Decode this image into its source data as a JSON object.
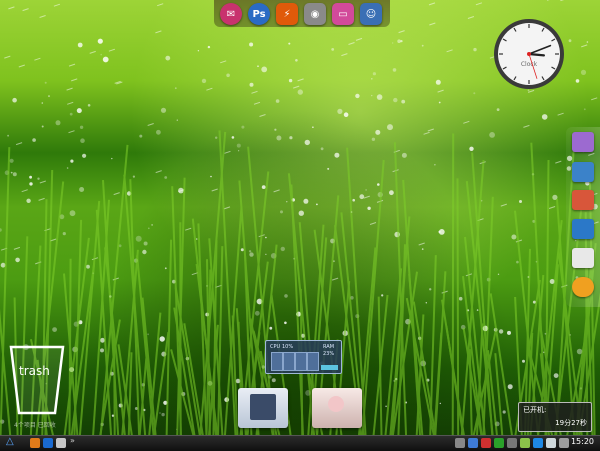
{
  "desktop": {
    "trash": {
      "label": "trash",
      "sublabel": "4个项目 已回收"
    },
    "clock": {
      "brand": "Clock",
      "hour": 3,
      "minute": 11,
      "second": 27
    },
    "sysmon": {
      "cpu_label": "CPU",
      "cpu_value": "10%",
      "ram_label": "RAM",
      "ram_value": "23%"
    },
    "uptime": {
      "label": "已开机:",
      "value": "19分27秒"
    }
  },
  "quick_launch": [
    {
      "name": "mail",
      "color": "#c8326e"
    },
    {
      "name": "photoshop",
      "text": "Ps",
      "color": "#2a6bc4"
    },
    {
      "name": "flash",
      "color": "#e05a0a"
    },
    {
      "name": "camera",
      "color": "#8a8a8a"
    },
    {
      "name": "cassette",
      "color": "#d24a9a"
    },
    {
      "name": "finder",
      "color": "#3a6fb5"
    }
  ],
  "right_dock": [
    {
      "name": "app-purple",
      "color": "#9c6ad0"
    },
    {
      "name": "app-blue",
      "color": "#3b82c9"
    },
    {
      "name": "app-photo",
      "color": "#d8563a"
    },
    {
      "name": "app-music",
      "color": "#2b78c8"
    },
    {
      "name": "app-doc",
      "color": "#e8e8e8"
    },
    {
      "name": "app-flower",
      "color": "#f0a020"
    }
  ],
  "taskbar": {
    "start_label": "△",
    "clock": "15:20"
  }
}
